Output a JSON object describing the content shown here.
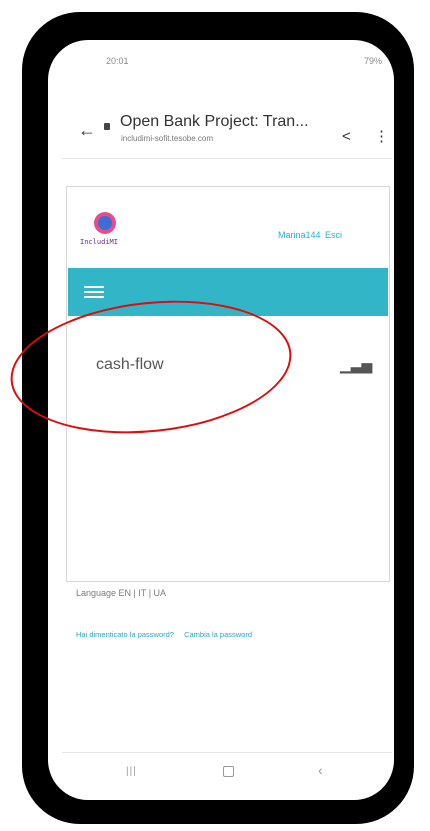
{
  "status_bar": {
    "time": "20:01",
    "right": "79%"
  },
  "browser": {
    "title": "Open Bank Project: Tran...",
    "domain": "includimi-sofit.tesobe.com"
  },
  "app": {
    "logo_text": "IncludiMI",
    "username": "Marina144",
    "exit_label": "Esci",
    "row_label": "cash-flow"
  },
  "footer": {
    "language_line": "Language EN | IT | UA",
    "forgot_link": "Hai dimenticato la password?",
    "change_link": "Cambia la password"
  },
  "colors": {
    "accent": "#31b5c7",
    "annotation": "#e10b0b",
    "link": "#2aa7bf"
  }
}
